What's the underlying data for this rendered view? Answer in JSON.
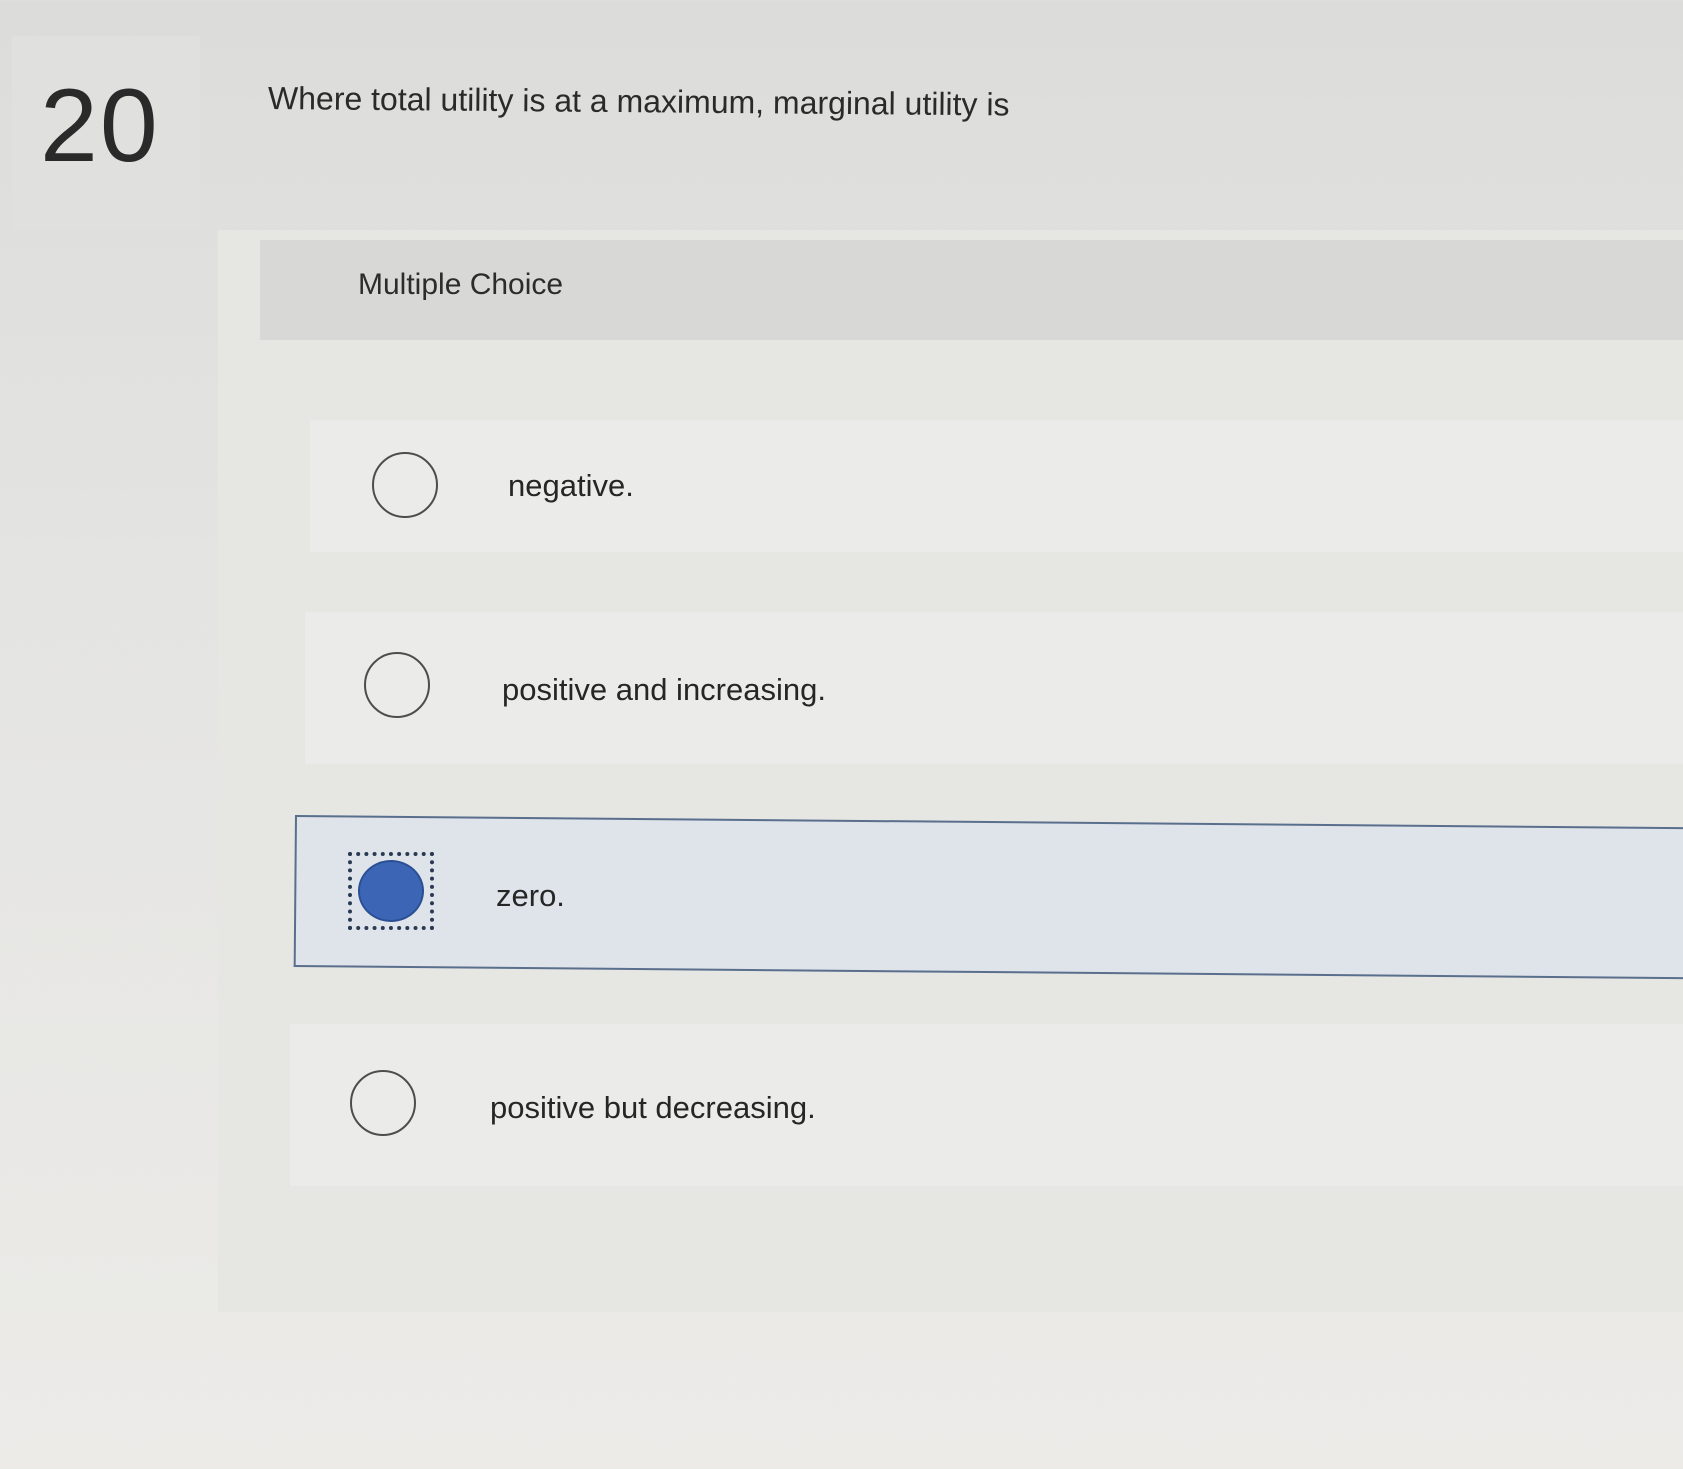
{
  "question": {
    "number": "20",
    "text": "Where total utility is at a maximum, marginal utility is"
  },
  "multiple_choice": {
    "label": "Multiple Choice",
    "options": [
      {
        "label": "negative.",
        "selected": false
      },
      {
        "label": "positive and increasing.",
        "selected": false
      },
      {
        "label": "zero.",
        "selected": true
      },
      {
        "label": "positive but decreasing.",
        "selected": false
      }
    ]
  },
  "colors": {
    "selected_radio": "#3c66b5",
    "selected_border": "#5a6f8c"
  }
}
